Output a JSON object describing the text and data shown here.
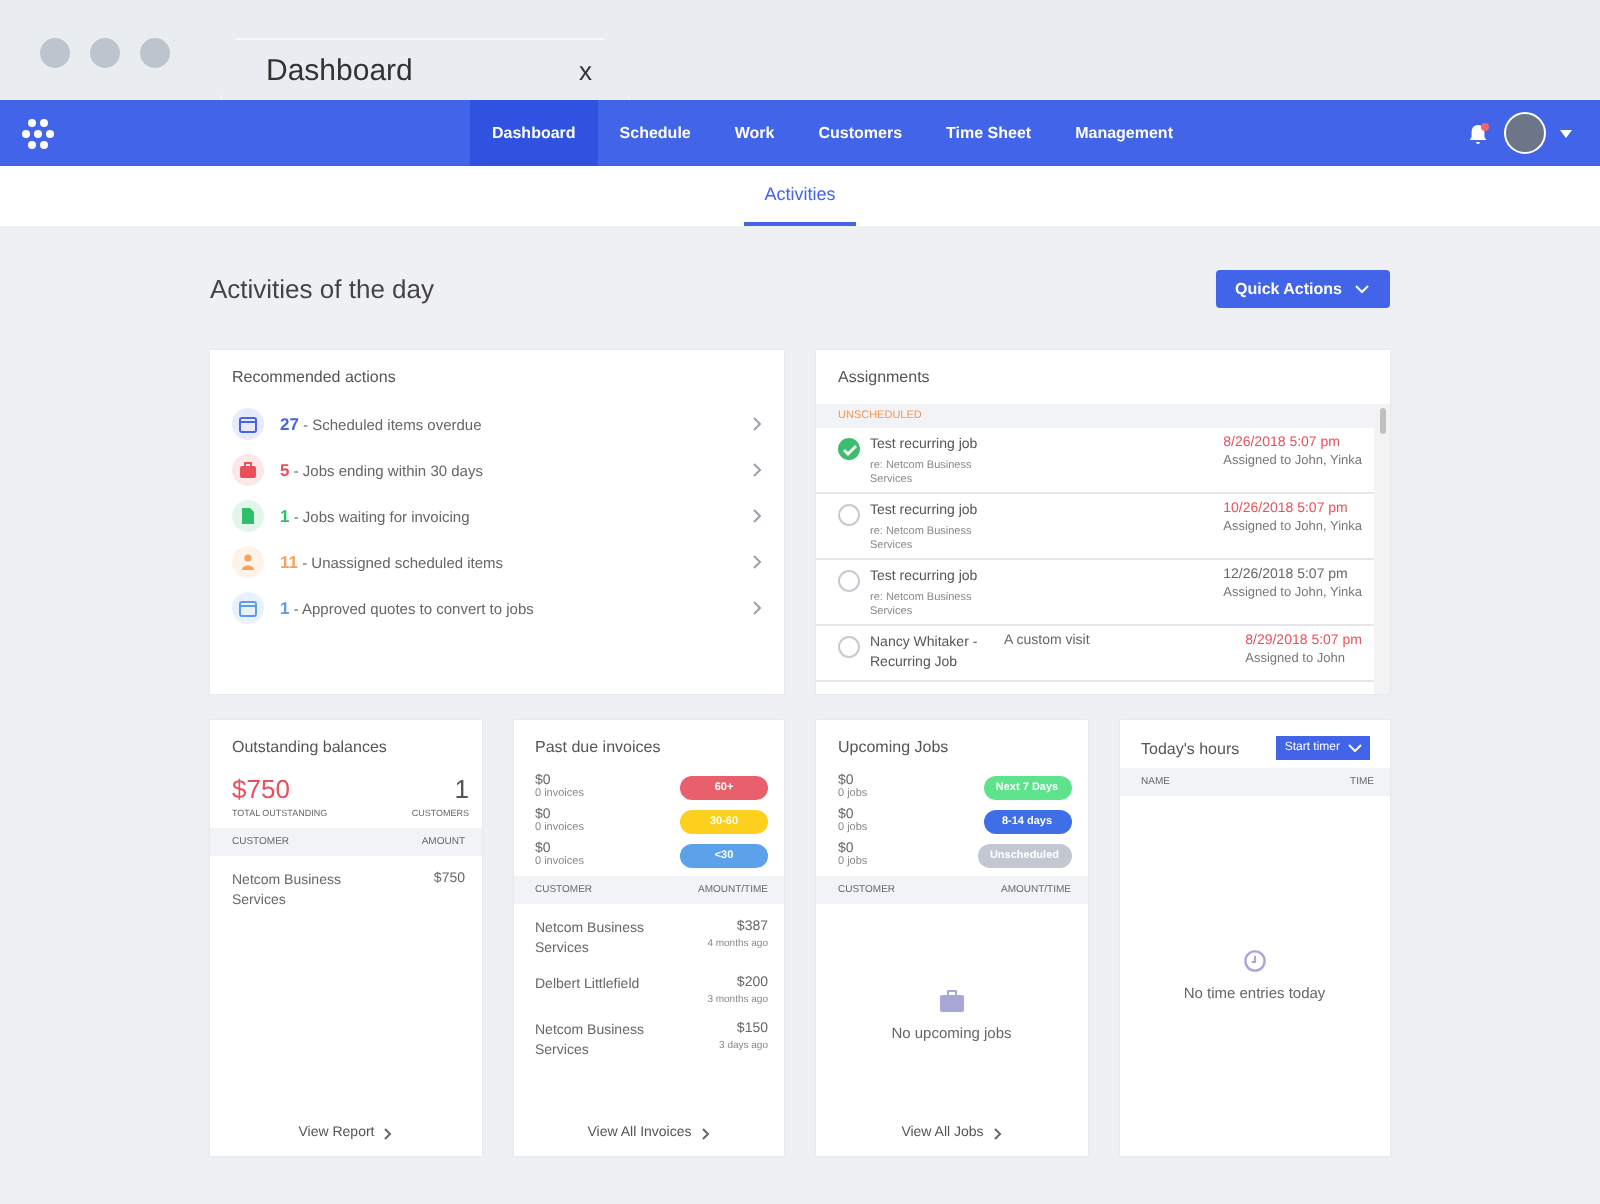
{
  "browser": {
    "tab_title": "Dashboard",
    "tab_close": "x"
  },
  "nav": {
    "items": [
      {
        "label": "Dashboard",
        "selected": true
      },
      {
        "label": "Schedule",
        "selected": false
      },
      {
        "label": "Work",
        "selected": false
      },
      {
        "label": "Customers",
        "selected": false
      },
      {
        "label": "Time Sheet",
        "selected": false
      },
      {
        "label": "Management",
        "selected": false
      }
    ]
  },
  "subnav": {
    "tabs": [
      {
        "label": "Activities",
        "selected": true
      }
    ]
  },
  "page": {
    "title": "Activities of the day",
    "quick_actions": "Quick Actions"
  },
  "recommended": {
    "title": "Recommended actions",
    "items": [
      {
        "count": "27",
        "text": "- Scheduled items overdue",
        "color": "#4a63e0",
        "kind": "calendar"
      },
      {
        "count": "5",
        "text": "- Jobs ending within 30 days",
        "color": "#e8505b",
        "kind": "briefcase"
      },
      {
        "count": "1",
        "text": "- Jobs waiting for invoicing",
        "color": "#2fbf6a",
        "kind": "document"
      },
      {
        "count": "11",
        "text": "- Unassigned scheduled items",
        "color": "#f5a25d",
        "kind": "person"
      },
      {
        "count": "1",
        "text": "- Approved quotes to convert to jobs",
        "color": "#5b9bea",
        "kind": "calendar"
      }
    ]
  },
  "assignments": {
    "title": "Assignments",
    "section": "UNSCHEDULED",
    "rows": [
      {
        "title": "Test recurring job",
        "customer": "re: Netcom Business Services",
        "note": "",
        "date": "8/26/2018 5:07 pm",
        "assigned": "Assigned to John, Yinka",
        "checked": true,
        "overdue": true
      },
      {
        "title": "Test recurring job",
        "customer": "re: Netcom Business Services",
        "note": "",
        "date": "10/26/2018 5:07 pm",
        "assigned": "Assigned to John, Yinka",
        "checked": false,
        "overdue": true
      },
      {
        "title": "Test recurring job",
        "customer": "re: Netcom Business Services",
        "note": "",
        "date": "12/26/2018 5:07 pm",
        "assigned": "Assigned to John, Yinka",
        "checked": false,
        "overdue": false
      },
      {
        "title": "Nancy Whitaker - Recurring Job",
        "customer": "",
        "note": "A custom visit",
        "date": "8/29/2018 5:07 pm",
        "assigned": "Assigned to John",
        "checked": false,
        "overdue": true
      }
    ]
  },
  "outstanding": {
    "title": "Outstanding balances",
    "total": "$750",
    "total_label": "TOTAL OUTSTANDING",
    "customers": "1",
    "customers_label": "CUSTOMERS",
    "columns": [
      "CUSTOMER",
      "AMOUNT"
    ],
    "rows": [
      {
        "customer": "Netcom Business Services",
        "amount": "$750"
      }
    ],
    "link": "View Report"
  },
  "past_due": {
    "title": "Past due invoices",
    "buckets": [
      {
        "amount": "$0",
        "count": "0 invoices",
        "badge": "60+",
        "color": "#e8606c"
      },
      {
        "amount": "$0",
        "count": "0 invoices",
        "badge": "30-60",
        "color": "#fcd01c"
      },
      {
        "amount": "$0",
        "count": "0 invoices",
        "badge": "<30",
        "color": "#5ba2ea"
      }
    ],
    "columns": [
      "CUSTOMER",
      "AMOUNT/TIME"
    ],
    "rows": [
      {
        "customer": "Netcom Business Services",
        "amount": "$387",
        "time": "4 months ago"
      },
      {
        "customer": "Delbert Littlefield",
        "amount": "$200",
        "time": "3 months ago"
      },
      {
        "customer": "Netcom Business Services",
        "amount": "$150",
        "time": "3 days ago"
      }
    ],
    "link": "View All Invoices"
  },
  "upcoming": {
    "title": "Upcoming Jobs",
    "buckets": [
      {
        "amount": "$0",
        "count": "0 jobs",
        "badge": "Next 7 Days",
        "color": "#5ee38c"
      },
      {
        "amount": "$0",
        "count": "0 jobs",
        "badge": "8-14 days",
        "color": "#3f6fe6"
      },
      {
        "amount": "$0",
        "count": "0 jobs",
        "badge": "Unscheduled",
        "color": "#c3c8d0"
      }
    ],
    "columns": [
      "CUSTOMER",
      "AMOUNT/TIME"
    ],
    "empty": "No upcoming jobs",
    "link": "View All Jobs"
  },
  "hours": {
    "title": "Today's hours",
    "button": "Start timer",
    "columns": [
      "NAME",
      "TIME"
    ],
    "empty": "No time entries today"
  }
}
